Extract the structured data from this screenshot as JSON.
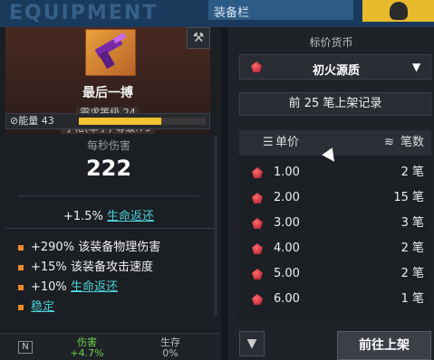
{
  "banner": {
    "title": "装备栏"
  },
  "item": {
    "name": "最后一搏",
    "requirement": "需求等级 24",
    "type_level": "手枪(单手) 等级.79",
    "energy_label": "能量 43",
    "energy_fraction": 0.65
  },
  "stats": {
    "dps_label": "每秒伤害",
    "dps_value": "222",
    "lifesteal_value": "+1.5%",
    "lifesteal_label": "生命返还",
    "mods": [
      {
        "value": "+290%",
        "label": "该装备物理伤害"
      },
      {
        "value": "+15%",
        "label": "该装备攻击速度"
      },
      {
        "value": "+10%",
        "label": "生命返还"
      },
      {
        "value": "",
        "label": "稳定"
      }
    ]
  },
  "compare": {
    "badge": "N",
    "damage_label": "伤害",
    "damage_value": "+4.7%",
    "survival_label": "生存",
    "survival_value": "0%"
  },
  "market": {
    "currency_label": "标价货币",
    "currency_selected": "初火源质",
    "records_button": "前 25 笔上架记录",
    "table_headers": {
      "price": "单价",
      "count": "笔数"
    },
    "rows": [
      {
        "price": "1.00",
        "count": "2 笔"
      },
      {
        "price": "2.00",
        "count": "15 笔"
      },
      {
        "price": "3.00",
        "count": "3 笔"
      },
      {
        "price": "4.00",
        "count": "2 笔"
      },
      {
        "price": "5.00",
        "count": "2 笔"
      },
      {
        "price": "6.00",
        "count": "1 笔"
      }
    ],
    "list_button": "前往上架"
  },
  "colors": {
    "accent_gold": "#e9b92d",
    "link_cyan": "#4ad0d6",
    "mod_orange": "#e98a2a",
    "damage_green": "#6fd04a"
  }
}
